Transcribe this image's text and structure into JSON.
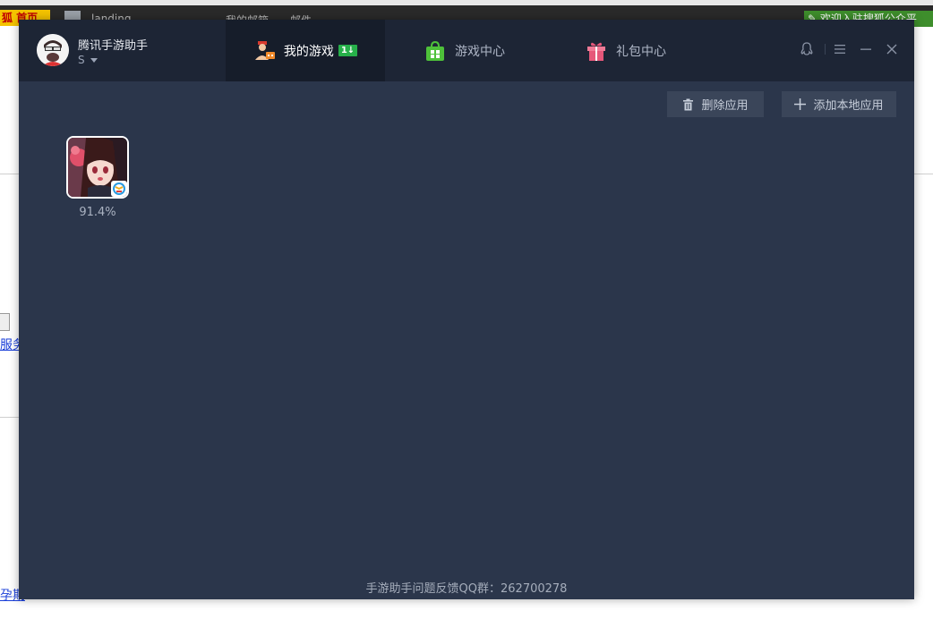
{
  "background": {
    "logo_text": "狐 首页",
    "top_links": [
      "landing",
      "我的邮箱",
      "邮件"
    ],
    "promo_text": "欢迎入驻搜狐公众平",
    "side_links": [
      "服务",
      "孕期"
    ]
  },
  "app": {
    "name": "腾讯手游助手",
    "user": "S",
    "tabs": [
      {
        "label": "我的游戏",
        "badge": "1↓",
        "active": true
      },
      {
        "label": "游戏中心",
        "active": false
      },
      {
        "label": "礼包中心",
        "active": false
      }
    ],
    "actions": {
      "delete_label": "删除应用",
      "add_local_label": "添加本地应用"
    },
    "games": [
      {
        "progress": "91.4%"
      }
    ],
    "footer": "手游助手问题反馈QQ群：262700278",
    "colors": {
      "window_bg": "#2b364b",
      "header_bg": "#1d2535",
      "active_tab_bg": "#161d2a",
      "badge_green": "#27b04a",
      "button_bg": "#3a4559"
    }
  }
}
